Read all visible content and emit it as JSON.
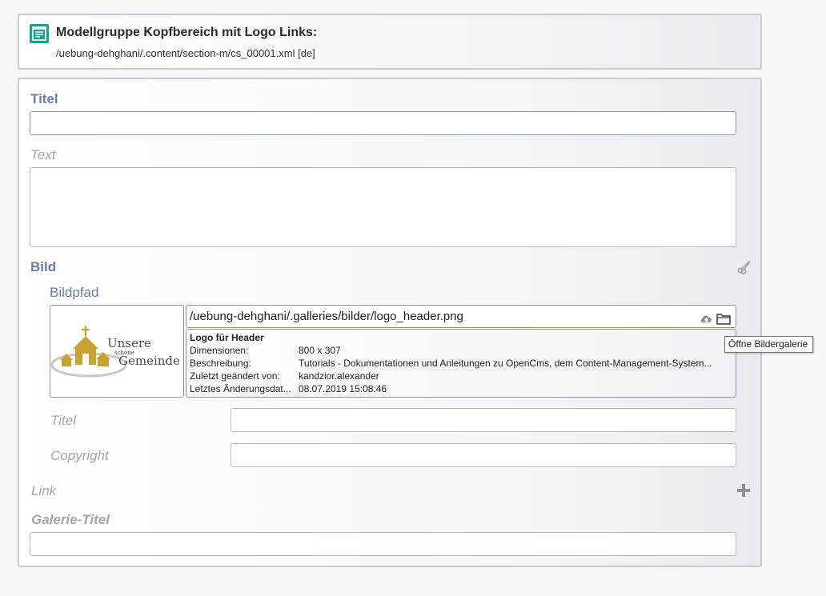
{
  "header": {
    "title": "Modellgruppe Kopfbereich mit Logo Links:",
    "path": "/uebung-dehghani/.content/section-m/cs_00001.xml [de]"
  },
  "form": {
    "titel_label": "Titel",
    "text_label": "Text",
    "bild_label": "Bild",
    "bildpfad_label": "Bildpfad",
    "image_path": "/uebung-dehghani/.galleries/bilder/logo_header.png",
    "image_info": {
      "title": "Logo für Header",
      "rows": [
        {
          "key": "Dimensionen:",
          "value": "800 x 307"
        },
        {
          "key": "Beschreibung:",
          "value": "Tutorials - Dokumentationen und Anleitungen zu OpenCms, dem Content-Management-System..."
        },
        {
          "key": "Zuletzt geändert von:",
          "value": "kandzior.alexander"
        },
        {
          "key": "Letztes Änderungsdat...",
          "value": "08.07.2019 15:08:46"
        }
      ]
    },
    "logo": {
      "line1": "Unsere",
      "line2": "schöne",
      "line3": "Gemeinde"
    },
    "bild_titel_label": "Titel",
    "copyright_label": "Copyright",
    "link_label": "Link",
    "galerie_titel_label": "Galerie-Titel"
  },
  "tooltip": "Öffne Bildergalerie",
  "colors": {
    "accent_label": "#6a7ea6",
    "icon_teal": "#1aa192",
    "logo_gold": "#c8a232"
  },
  "icons": [
    "content-icon",
    "scissors-icon",
    "upload-cloud-icon",
    "folder-icon",
    "plus-icon"
  ]
}
